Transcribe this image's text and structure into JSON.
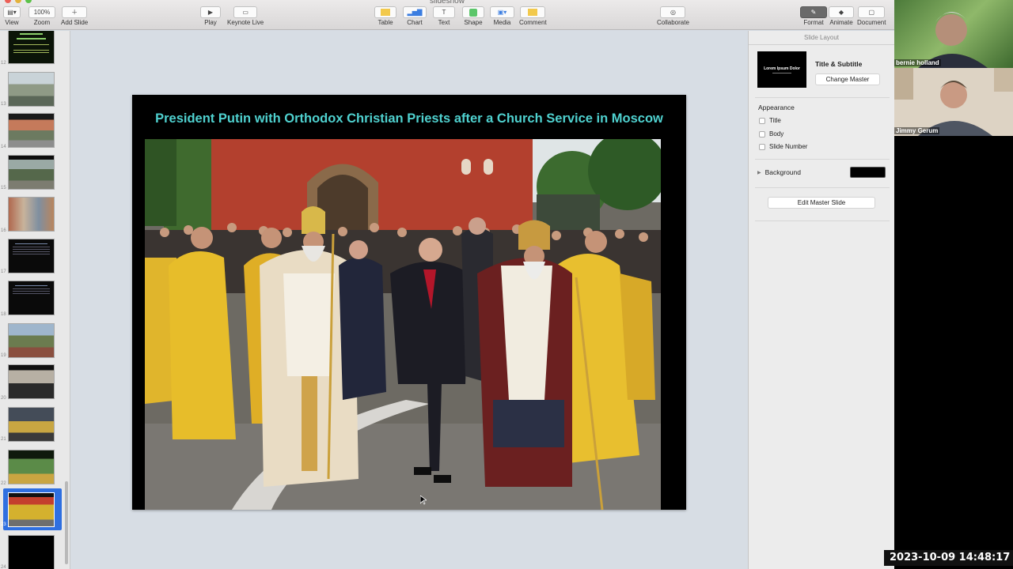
{
  "window": {
    "title": "slideshow"
  },
  "toolbar": {
    "view_label": "View",
    "zoom_value": "100%",
    "zoom_label": "Zoom",
    "add_slide_label": "Add Slide",
    "play_label": "Play",
    "keynote_live_label": "Keynote Live",
    "table_label": "Table",
    "chart_label": "Chart",
    "text_label": "Text",
    "shape_label": "Shape",
    "media_label": "Media",
    "comment_label": "Comment",
    "collaborate_label": "Collaborate",
    "format_label": "Format",
    "animate_label": "Animate",
    "document_label": "Document"
  },
  "navigator": {
    "slide_numbers": [
      "12",
      "13",
      "14",
      "15",
      "16",
      "17",
      "18",
      "19",
      "20",
      "21",
      "22",
      "23",
      "24"
    ]
  },
  "slide": {
    "title": "President Putin with Orthodox Christian Priests after a Church Service in Moscow"
  },
  "inspector": {
    "header": "Slide Layout",
    "master_name": "Title & Subtitle",
    "master_thumb_text": "Lorem Ipsum Dolor",
    "change_master_label": "Change Master",
    "appearance_label": "Appearance",
    "options": [
      {
        "label": "Title",
        "checked": false
      },
      {
        "label": "Body",
        "checked": false
      },
      {
        "label": "Slide Number",
        "checked": false
      }
    ],
    "background_label": "Background",
    "background_color": "#000000",
    "edit_master_label": "Edit Master Slide"
  },
  "participants": [
    {
      "name": "bernie holland"
    },
    {
      "name": "Jimmy Gerum"
    }
  ],
  "timestamp": "2023-10-09  14:48:17"
}
